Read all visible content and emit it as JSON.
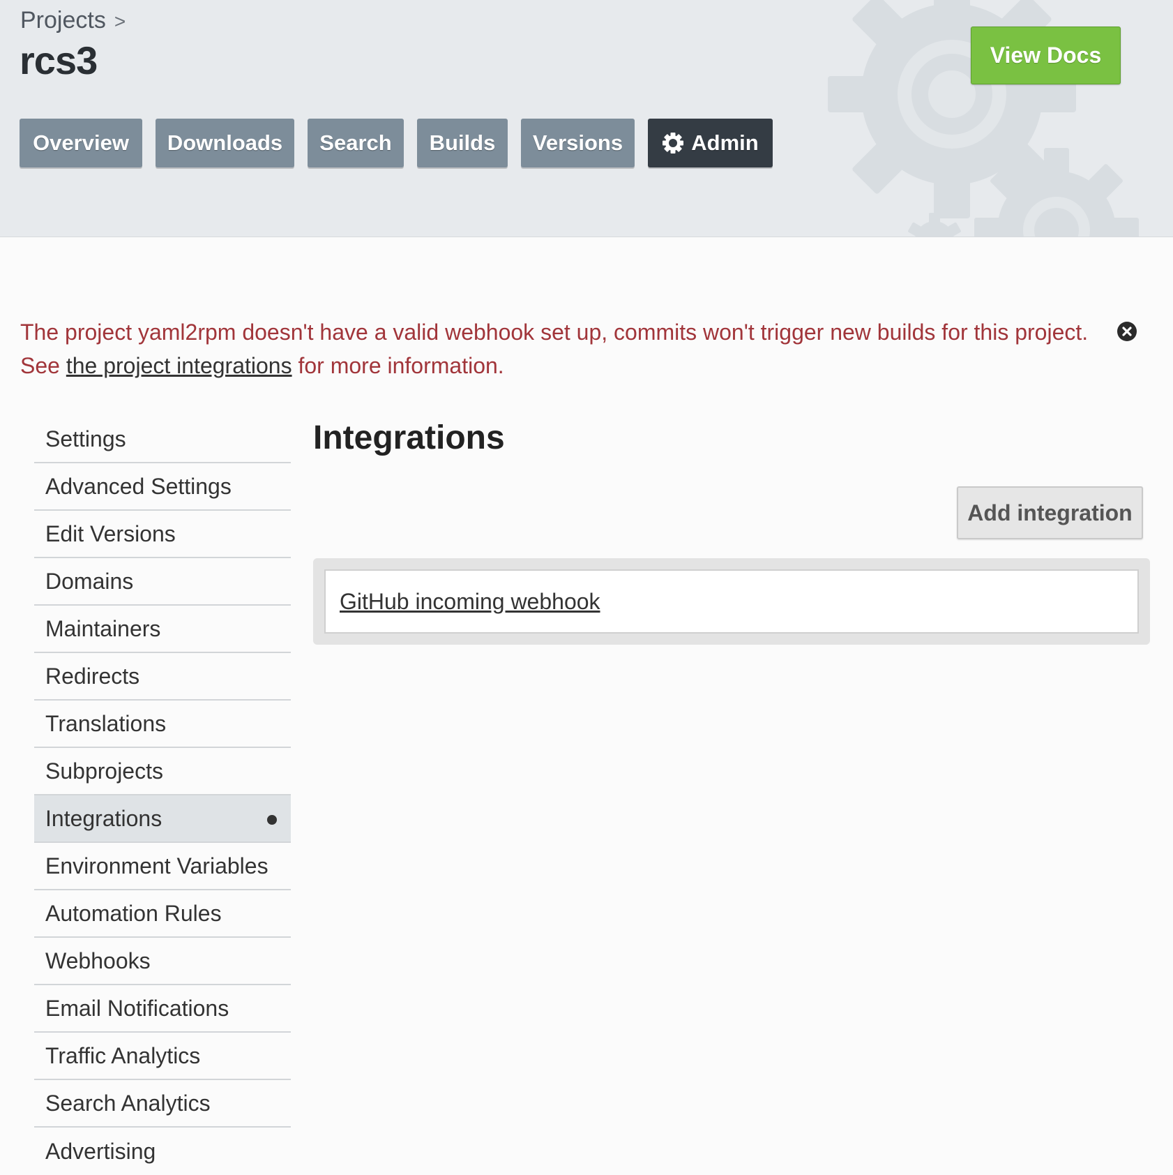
{
  "header": {
    "breadcrumb": {
      "parent": "Projects",
      "separator": ">"
    },
    "project_name": "rcs3",
    "view_docs_label": "View Docs",
    "tabs": [
      {
        "label": "Overview"
      },
      {
        "label": "Downloads"
      },
      {
        "label": "Search"
      },
      {
        "label": "Builds"
      },
      {
        "label": "Versions"
      },
      {
        "label": "Admin",
        "icon": "gear-icon",
        "active": true
      }
    ]
  },
  "alert": {
    "text_before": "The project yaml2rpm doesn't have a valid webhook set up, commits won't trigger new builds for this project. See ",
    "link_text": "the project integrations",
    "text_after": " for more information.",
    "close_icon": "close-icon"
  },
  "sidebar": {
    "items": [
      {
        "label": "Settings"
      },
      {
        "label": "Advanced Settings"
      },
      {
        "label": "Edit Versions"
      },
      {
        "label": "Domains"
      },
      {
        "label": "Maintainers"
      },
      {
        "label": "Redirects"
      },
      {
        "label": "Translations"
      },
      {
        "label": "Subprojects"
      },
      {
        "label": "Integrations",
        "active": true
      },
      {
        "label": "Environment Variables"
      },
      {
        "label": "Automation Rules"
      },
      {
        "label": "Webhooks"
      },
      {
        "label": "Email Notifications"
      },
      {
        "label": "Traffic Analytics"
      },
      {
        "label": "Search Analytics"
      },
      {
        "label": "Advertising"
      }
    ]
  },
  "main": {
    "title": "Integrations",
    "add_button_label": "Add integration",
    "integrations": [
      {
        "label": "GitHub incoming webhook"
      }
    ]
  },
  "colors": {
    "view_docs_green": "#7ac142",
    "nav_tab": "#7d8d9a",
    "nav_tab_active": "#343c44",
    "alert_red": "#a1353a"
  }
}
